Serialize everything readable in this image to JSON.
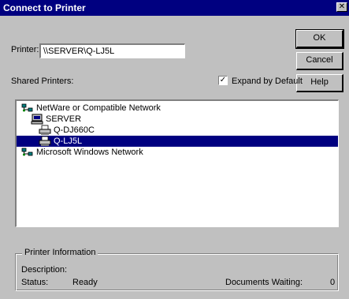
{
  "window": {
    "title": "Connect to Printer",
    "close_glyph": "✕"
  },
  "printer": {
    "label": "Printer:",
    "value": "\\\\SERVER\\Q-LJ5L"
  },
  "buttons": {
    "ok": "OK",
    "cancel": "Cancel",
    "help": "Help"
  },
  "shared_printers": {
    "label": "Shared Printers:",
    "expand_label": "Expand by Default",
    "expand_checked": true,
    "check_glyph": "✓"
  },
  "tree": {
    "items": [
      {
        "label": "NetWare or Compatible Network",
        "icon": "network-icon"
      },
      {
        "label": "SERVER",
        "icon": "server-icon"
      },
      {
        "label": "Q-DJ660C",
        "icon": "printer-icon"
      },
      {
        "label": "Q-LJ5L",
        "icon": "printer-icon",
        "selected": true
      },
      {
        "label": "Microsoft Windows Network",
        "icon": "network-icon"
      }
    ]
  },
  "printer_info": {
    "legend": "Printer Information",
    "description_label": "Description:",
    "description_value": "",
    "status_label": "Status:",
    "status_value": "Ready",
    "docs_label": "Documents Waiting:",
    "docs_value": "0"
  },
  "colors": {
    "titlebar": "#000080",
    "face": "#c0c0c0",
    "selection": "#000080"
  }
}
